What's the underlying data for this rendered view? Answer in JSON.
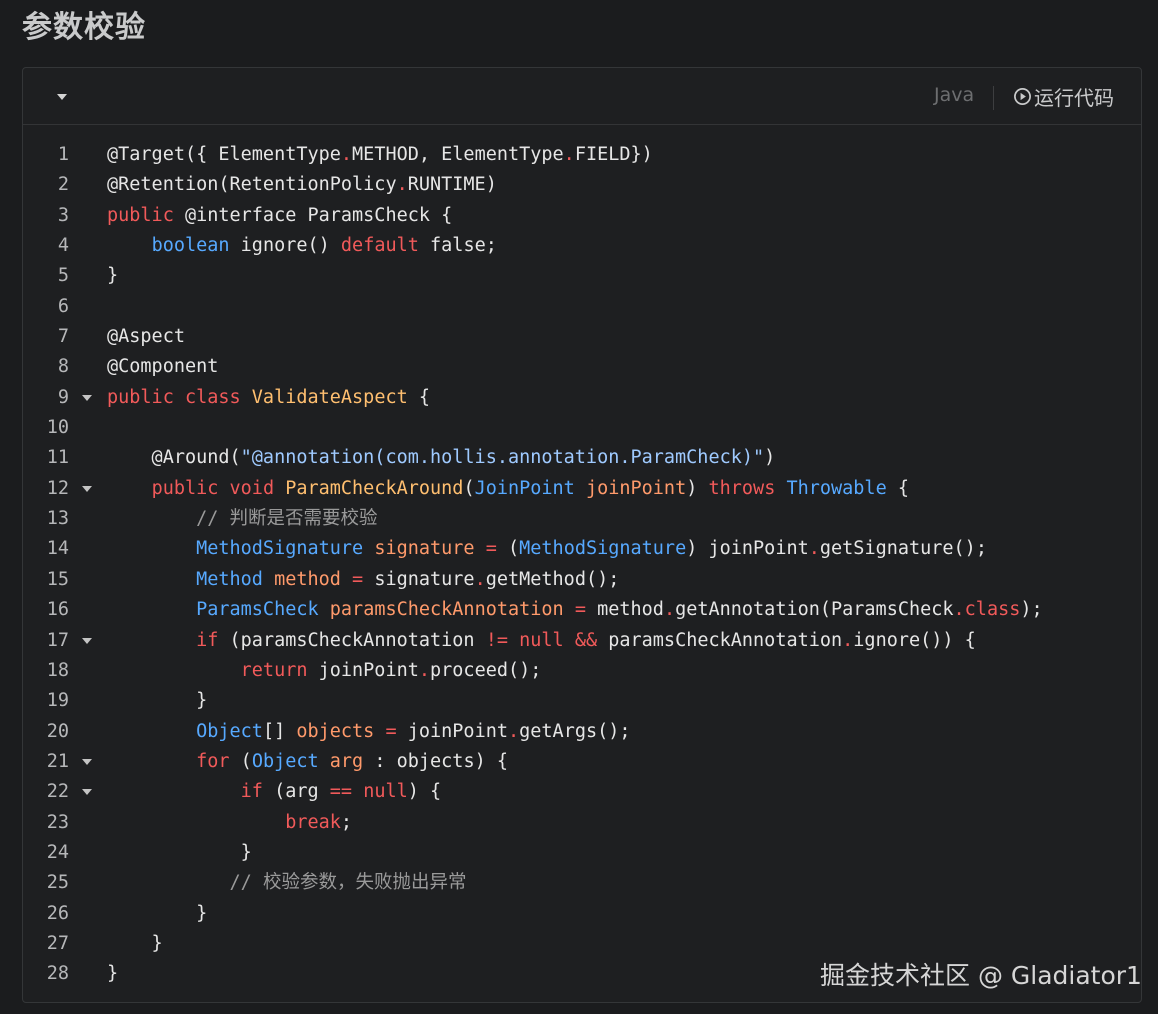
{
  "page": {
    "title": "参数校验"
  },
  "toolbar": {
    "language": "Java",
    "run_label": "运行代码"
  },
  "watermark": "掘金技术社区 @ Gladiator1",
  "code": {
    "lines": [
      {
        "n": "1",
        "fold": false,
        "tokens": [
          [
            "p",
            "@Target({ ElementType"
          ],
          [
            "o",
            "."
          ],
          [
            "p",
            "METHOD, ElementType"
          ],
          [
            "o",
            "."
          ],
          [
            "p",
            "FIELD})"
          ]
        ]
      },
      {
        "n": "2",
        "fold": false,
        "tokens": [
          [
            "p",
            "@Retention(RetentionPolicy"
          ],
          [
            "o",
            "."
          ],
          [
            "p",
            "RUNTIME)"
          ]
        ]
      },
      {
        "n": "3",
        "fold": false,
        "tokens": [
          [
            "k",
            "public"
          ],
          [
            "p",
            " @interface ParamsCheck {"
          ]
        ]
      },
      {
        "n": "4",
        "fold": false,
        "tokens": [
          [
            "p",
            "    "
          ],
          [
            "t",
            "boolean"
          ],
          [
            "p",
            " ignore() "
          ],
          [
            "k",
            "default"
          ],
          [
            "p",
            " false;"
          ]
        ]
      },
      {
        "n": "5",
        "fold": false,
        "tokens": [
          [
            "p",
            "}"
          ]
        ]
      },
      {
        "n": "6",
        "fold": false,
        "tokens": []
      },
      {
        "n": "7",
        "fold": false,
        "tokens": [
          [
            "p",
            "@Aspect"
          ]
        ]
      },
      {
        "n": "8",
        "fold": false,
        "tokens": [
          [
            "p",
            "@Component"
          ]
        ]
      },
      {
        "n": "9",
        "fold": true,
        "tokens": [
          [
            "k",
            "public class "
          ],
          [
            "c",
            "ValidateAspect"
          ],
          [
            "p",
            " {"
          ]
        ]
      },
      {
        "n": "10",
        "fold": false,
        "tokens": []
      },
      {
        "n": "11",
        "fold": false,
        "tokens": [
          [
            "p",
            "    @Around("
          ],
          [
            "s",
            "\"@annotation(com.hollis.annotation.ParamCheck)\""
          ],
          [
            "p",
            ")"
          ]
        ]
      },
      {
        "n": "12",
        "fold": true,
        "tokens": [
          [
            "p",
            "    "
          ],
          [
            "k",
            "public void "
          ],
          [
            "c",
            "ParamCheckAround"
          ],
          [
            "p",
            "("
          ],
          [
            "t",
            "JoinPoint"
          ],
          [
            "p",
            " "
          ],
          [
            "v",
            "joinPoint"
          ],
          [
            "p",
            ") "
          ],
          [
            "k",
            "throws"
          ],
          [
            "p",
            " "
          ],
          [
            "t",
            "Throwable"
          ],
          [
            "p",
            " {"
          ]
        ]
      },
      {
        "n": "13",
        "fold": false,
        "tokens": [
          [
            "p",
            "        "
          ],
          [
            "m",
            "// 判断是否需要校验"
          ]
        ]
      },
      {
        "n": "14",
        "fold": false,
        "tokens": [
          [
            "p",
            "        "
          ],
          [
            "t",
            "MethodSignature"
          ],
          [
            "p",
            " "
          ],
          [
            "v",
            "signature"
          ],
          [
            "p",
            " "
          ],
          [
            "o",
            "="
          ],
          [
            "p",
            " ("
          ],
          [
            "t",
            "MethodSignature"
          ],
          [
            "p",
            ") joinPoint"
          ],
          [
            "o",
            "."
          ],
          [
            "p",
            "getSignature();"
          ]
        ]
      },
      {
        "n": "15",
        "fold": false,
        "tokens": [
          [
            "p",
            "        "
          ],
          [
            "t",
            "Method"
          ],
          [
            "p",
            " "
          ],
          [
            "v",
            "method"
          ],
          [
            "p",
            " "
          ],
          [
            "o",
            "="
          ],
          [
            "p",
            " signature"
          ],
          [
            "o",
            "."
          ],
          [
            "p",
            "getMethod();"
          ]
        ]
      },
      {
        "n": "16",
        "fold": false,
        "tokens": [
          [
            "p",
            "        "
          ],
          [
            "t",
            "ParamsCheck"
          ],
          [
            "p",
            " "
          ],
          [
            "v",
            "paramsCheckAnnotation"
          ],
          [
            "p",
            " "
          ],
          [
            "o",
            "="
          ],
          [
            "p",
            " method"
          ],
          [
            "o",
            "."
          ],
          [
            "p",
            "getAnnotation(ParamsCheck"
          ],
          [
            "o",
            "."
          ],
          [
            "k",
            "class"
          ],
          [
            "p",
            ");"
          ]
        ]
      },
      {
        "n": "17",
        "fold": true,
        "tokens": [
          [
            "p",
            "        "
          ],
          [
            "k",
            "if"
          ],
          [
            "p",
            " (paramsCheckAnnotation "
          ],
          [
            "o",
            "!="
          ],
          [
            "p",
            " "
          ],
          [
            "k",
            "null"
          ],
          [
            "p",
            " "
          ],
          [
            "o",
            "&&"
          ],
          [
            "p",
            " paramsCheckAnnotation"
          ],
          [
            "o",
            "."
          ],
          [
            "p",
            "ignore()) {"
          ]
        ]
      },
      {
        "n": "18",
        "fold": false,
        "tokens": [
          [
            "p",
            "            "
          ],
          [
            "k",
            "return"
          ],
          [
            "p",
            " joinPoint"
          ],
          [
            "o",
            "."
          ],
          [
            "p",
            "proceed();"
          ]
        ]
      },
      {
        "n": "19",
        "fold": false,
        "tokens": [
          [
            "p",
            "        }"
          ]
        ]
      },
      {
        "n": "20",
        "fold": false,
        "tokens": [
          [
            "p",
            "        "
          ],
          [
            "t",
            "Object"
          ],
          [
            "p",
            "[] "
          ],
          [
            "v",
            "objects"
          ],
          [
            "p",
            " "
          ],
          [
            "o",
            "="
          ],
          [
            "p",
            " joinPoint"
          ],
          [
            "o",
            "."
          ],
          [
            "p",
            "getArgs();"
          ]
        ]
      },
      {
        "n": "21",
        "fold": true,
        "tokens": [
          [
            "p",
            "        "
          ],
          [
            "k",
            "for"
          ],
          [
            "p",
            " ("
          ],
          [
            "t",
            "Object"
          ],
          [
            "p",
            " "
          ],
          [
            "v",
            "arg"
          ],
          [
            "p",
            " : objects) {"
          ]
        ]
      },
      {
        "n": "22",
        "fold": true,
        "tokens": [
          [
            "p",
            "            "
          ],
          [
            "k",
            "if"
          ],
          [
            "p",
            " (arg "
          ],
          [
            "o",
            "=="
          ],
          [
            "p",
            " "
          ],
          [
            "k",
            "null"
          ],
          [
            "p",
            ") {"
          ]
        ]
      },
      {
        "n": "23",
        "fold": false,
        "tokens": [
          [
            "p",
            "                "
          ],
          [
            "k",
            "break"
          ],
          [
            "p",
            ";"
          ]
        ]
      },
      {
        "n": "24",
        "fold": false,
        "tokens": [
          [
            "p",
            "            }"
          ]
        ]
      },
      {
        "n": "25",
        "fold": false,
        "tokens": [
          [
            "p",
            "           "
          ],
          [
            "m",
            "// 校验参数，失败抛出异常"
          ]
        ]
      },
      {
        "n": "26",
        "fold": false,
        "tokens": [
          [
            "p",
            "        }"
          ]
        ]
      },
      {
        "n": "27",
        "fold": false,
        "tokens": [
          [
            "p",
            "    }"
          ]
        ]
      },
      {
        "n": "28",
        "fold": false,
        "tokens": [
          [
            "p",
            "}"
          ]
        ]
      }
    ]
  }
}
